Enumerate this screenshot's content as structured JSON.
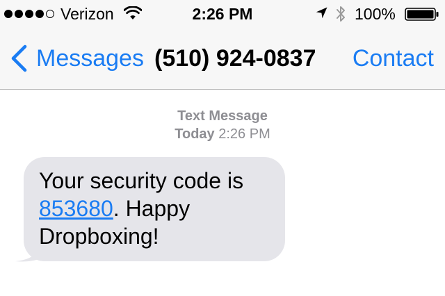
{
  "status_bar": {
    "signal_bars_filled": 4,
    "signal_bars_total": 5,
    "carrier": "Verizon",
    "time": "2:26 PM",
    "battery_percent": "100%",
    "icons": [
      "signal-dots-icon",
      "wifi-icon",
      "location-arrow-icon",
      "bluetooth-icon",
      "battery-icon"
    ]
  },
  "nav": {
    "back_label": "Messages",
    "title": "(510) 924-0837",
    "contact_label": "Contact",
    "accent_color": "#1a7cf3"
  },
  "conversation": {
    "service": "Text Message",
    "day": "Today",
    "time": "2:26 PM",
    "messages": [
      {
        "direction": "incoming",
        "text_before": "Your security code is ",
        "code": "853680",
        "text_after": ". Happy Dropboxing!"
      }
    ],
    "bubble_color": "#e5e5ea"
  }
}
